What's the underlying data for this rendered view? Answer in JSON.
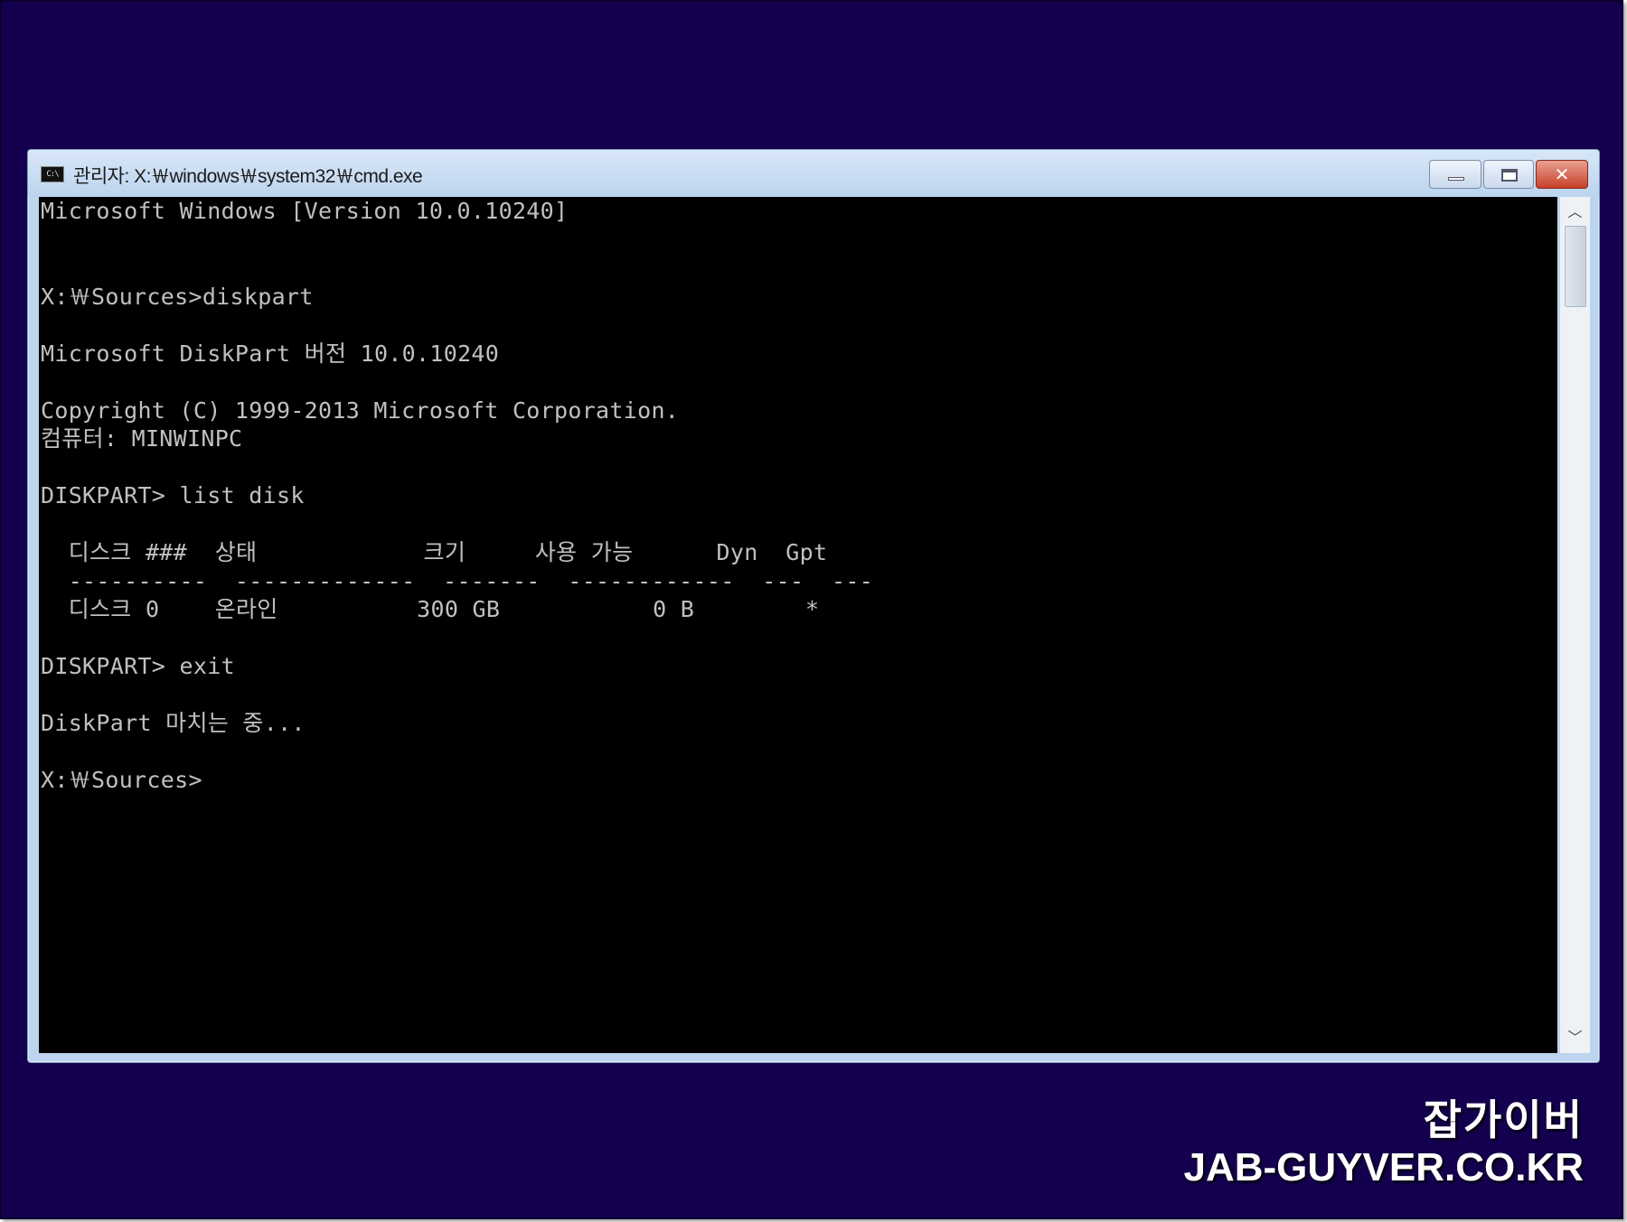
{
  "window": {
    "icon_label": "C:\\",
    "title": "관리자: X:￦windows￦system32￦cmd.exe",
    "close_symbol": "✕"
  },
  "console": {
    "lines": [
      "Microsoft Windows [Version 10.0.10240]",
      "",
      "",
      "X:￦Sources>diskpart",
      "",
      "Microsoft DiskPart 버전 10.0.10240",
      "",
      "Copyright (C) 1999-2013 Microsoft Corporation.",
      "컴퓨터: MINWINPC",
      "",
      "DISKPART> list disk",
      "",
      "  디스크 ###  상태            크기     사용 가능      Dyn  Gpt",
      "  ----------  -------------  -------  ------------  ---  ---",
      "  디스크 0    온라인          300 GB           0 B        *",
      "",
      "DISKPART> exit",
      "",
      "DiskPart 마치는 중...",
      "",
      "X:￦Sources>"
    ]
  },
  "scrollbar": {
    "up_symbol": "︿",
    "down_symbol": "﹀"
  },
  "watermark": {
    "korean": "잡가이버",
    "domain": "JAB-GUYVER.CO.KR"
  }
}
